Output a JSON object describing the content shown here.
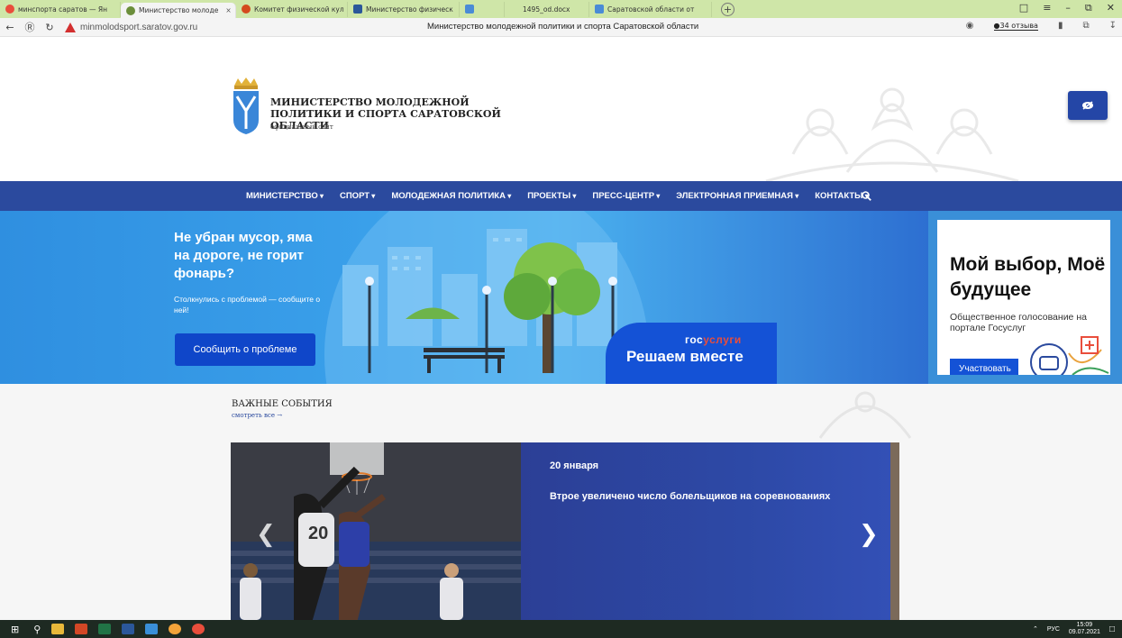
{
  "browser": {
    "tabs": [
      {
        "label": "минспорта саратов — Ян",
        "color": "#e94e3c",
        "active": false
      },
      {
        "label": "Министерство молоде",
        "color": "#6b8e3a",
        "active": true
      },
      {
        "label": "Комитет физической кул",
        "color": "#d44a1e",
        "active": false
      },
      {
        "label": "Министерство физическ",
        "color": "#2b579a",
        "active": false
      },
      {
        "label": "",
        "color": "#4a8bd6",
        "active": false
      },
      {
        "label": "1495_od.docx",
        "color": "",
        "active": false
      },
      {
        "label": "Саратовской области от",
        "color": "#4a8bd6",
        "active": false
      }
    ],
    "close_glyph": "×",
    "new_tab": "+",
    "url": "minmolodsport.saratov.gov.ru",
    "page_title": "Министерство молодежной политики и спорта Саратовской области",
    "reviews": "34 отзыва"
  },
  "header": {
    "org_name": "МИНИСТЕРСТВО МОЛОДЕЖНОЙ ПОЛИТИКИ И СПОРТА САРАТОВСКОЙ ОБЛАСТИ",
    "org_sub": "официальный сайт"
  },
  "nav": {
    "items": [
      "МИНИСТЕРСТВО",
      "СПОРТ",
      "МОЛОДЕЖНАЯ ПОЛИТИКА",
      "ПРОЕКТЫ",
      "ПРЕСС-ЦЕНТР",
      "ЭЛЕКТРОННАЯ ПРИЕМНАЯ",
      "КОНТАКТЫ"
    ]
  },
  "banner": {
    "headline": "Не убран мусор, яма на дороге, не горит фонарь?",
    "subtext": "Столкнулись с проблемой — сообщите о ней!",
    "button": "Сообщить о проблеме",
    "gos_prefix": "гос",
    "gos_suffix": "услуги",
    "slogan": "Решаем вместе"
  },
  "vote_card": {
    "title": "Мой выбор, Моё будущее",
    "subtitle": "Общественное голосование на портале Госуслуг",
    "button": "Участвовать"
  },
  "events": {
    "heading": "ВАЖНЫЕ СОБЫТИЯ",
    "see_all": "смотреть все →",
    "date": "20 января",
    "caption": "Втрое увеличено число болельщиков на соревнованиях",
    "jersey_number": "20"
  },
  "taskbar": {
    "lang": "РУС",
    "time": "15:09",
    "date": "09.07.2021"
  }
}
